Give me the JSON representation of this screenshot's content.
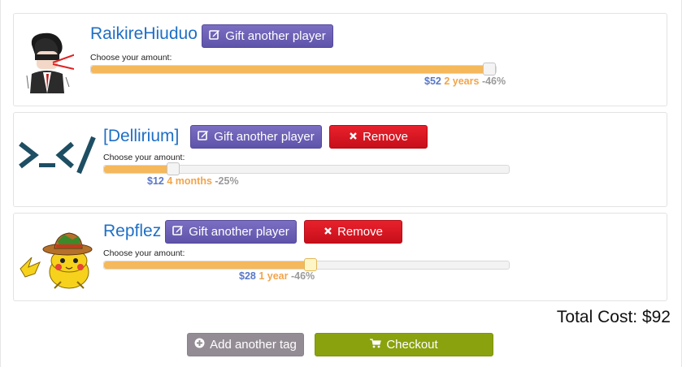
{
  "players": [
    {
      "name": "RaikireHiuduo",
      "gift_label": "Gift another player",
      "remove_label": null,
      "choose_label": "Choose your amount:",
      "slider_fraction": 1.0,
      "price": "$52",
      "duration": "2 years",
      "discount": "-46%"
    },
    {
      "name": "[Dellirium]",
      "gift_label": "Gift another player",
      "remove_label": "Remove",
      "choose_label": "Choose your amount:",
      "slider_fraction": 0.17,
      "price": "$12",
      "duration": "4 months",
      "discount": "-25%"
    },
    {
      "name": "Repflez",
      "gift_label": "Gift another player",
      "remove_label": "Remove",
      "choose_label": "Choose your amount:",
      "slider_fraction": 0.51,
      "price": "$28",
      "duration": "1 year",
      "discount": "-46%"
    }
  ],
  "total_label": "Total Cost: $92",
  "add_tag_label": "Add another tag",
  "checkout_label": "Checkout",
  "colors": {
    "name": "#1e6fc6",
    "gift_button": "#6a5fb5",
    "remove_button": "#d91621",
    "add_button": "#948c95",
    "checkout_button": "#8aa20e",
    "slider_fill": "#f5b85a",
    "price": "#5a78c8",
    "duration": "#f2a44a",
    "discount": "#9a9a9a"
  },
  "icons": {
    "gift": "edit-icon",
    "remove": "x-icon",
    "add": "plus-circle-icon",
    "checkout": "cart-icon"
  }
}
